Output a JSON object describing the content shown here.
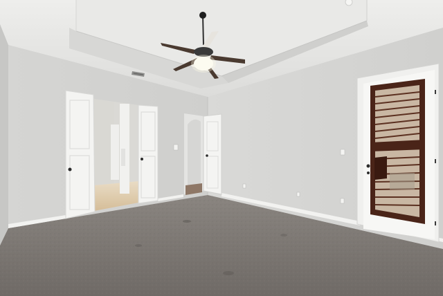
{
  "scene": {
    "subject": "empty-bedroom-interior",
    "elements": [
      "tray-ceiling",
      "ceiling-fan-with-light",
      "hvac-vent",
      "double-doors-to-hallway",
      "interior-doorway-left-wall",
      "exterior-glass-door-with-shutters",
      "light-switch",
      "electrical-outlets",
      "carpet-floor",
      "baseboards"
    ],
    "colors": {
      "wall": "#d3d3d1",
      "wall_shadow": "#c9c9c7",
      "ceiling": "#e6e6e4",
      "carpet": "#7d7873",
      "door_white": "#f4f4f2",
      "shutter_wood": "#4a2418",
      "shutter_slat": "#c9b7a3",
      "hall_floor": "#d8c3a3"
    }
  }
}
